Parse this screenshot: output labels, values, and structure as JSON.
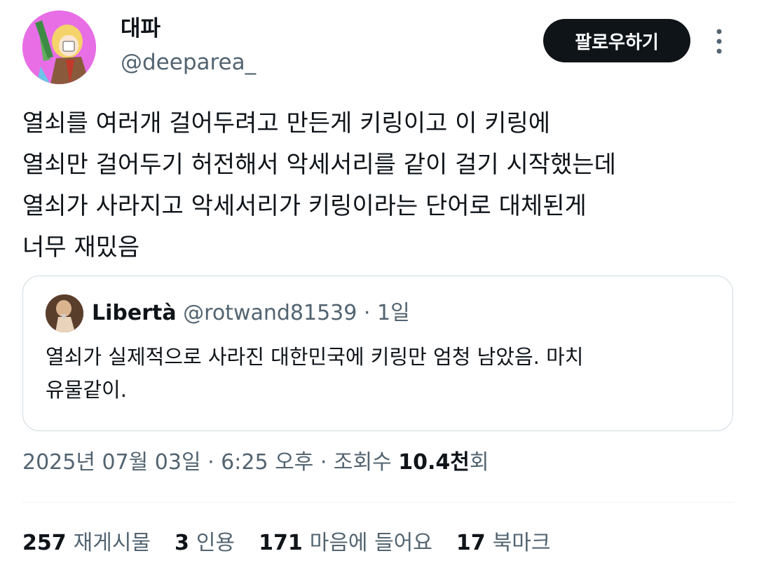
{
  "author": {
    "display_name": "대파",
    "handle": "@deeparea_"
  },
  "follow_label": "팔로우하기",
  "tweet_text": "열쇠를 여러개 걸어두려고 만든게 키링이고 이 키링에\n열쇠만 걸어두기 허전해서 악세서리를 같이 걸기 시작했는데\n열쇠가 사라지고 악세서리가 키링이라는 단어로 대체된게\n너무 재밌음",
  "quote": {
    "name": "Libertà",
    "handle": "@rotwand81539",
    "separator": "·",
    "time": "1일",
    "text": "열쇠가 실제적으로 사라진 대한민국에 키링만 엄청 남았음. 마치\n유물같이."
  },
  "meta": {
    "date_time": "2025년 07월 03일 · 6:25 오후 · 조회수 ",
    "views_value": "10.4천",
    "views_suffix": "회"
  },
  "stats": [
    {
      "count": "257",
      "label": "재게시물"
    },
    {
      "count": "3",
      "label": "인용"
    },
    {
      "count": "171",
      "label": "마음에 들어요"
    },
    {
      "count": "17",
      "label": "북마크"
    }
  ],
  "colors": {
    "text": "#0f1419",
    "secondary": "#536471",
    "border": "#cfd9de",
    "button": "#0f1419",
    "avatar_bg": "#e86ee6"
  },
  "icons": [
    "more-options-icon"
  ]
}
